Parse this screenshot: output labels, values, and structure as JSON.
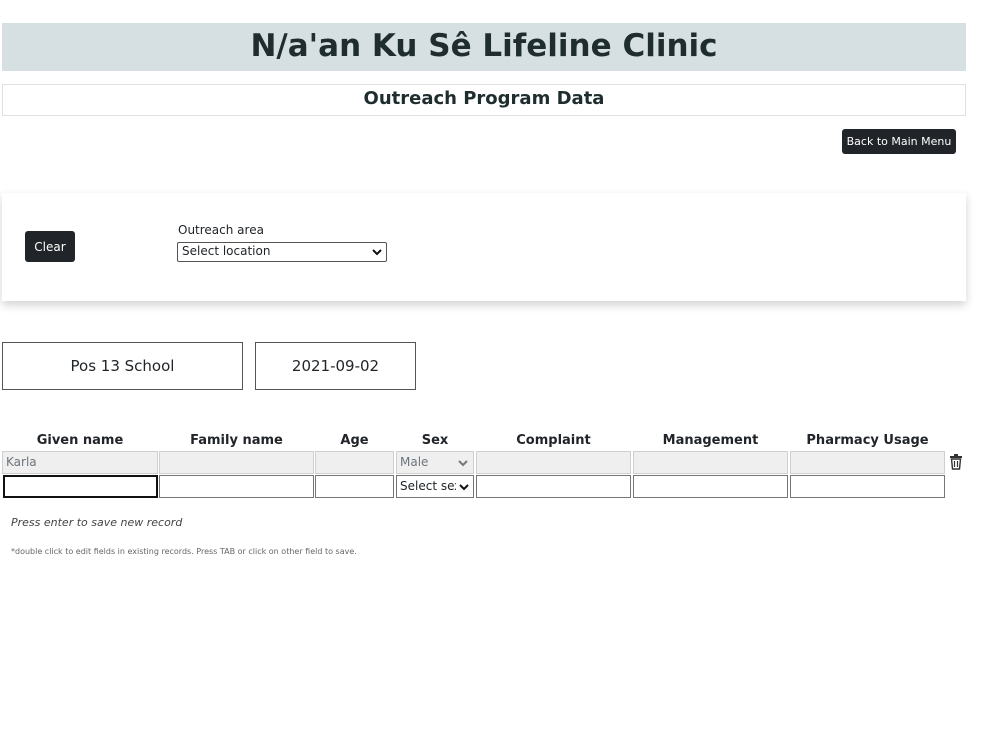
{
  "header": {
    "title": "N/a'an Ku Sê Lifeline Clinic",
    "subtitle": "Outreach Program Data"
  },
  "nav": {
    "back_label": "Back to Main Menu"
  },
  "filter": {
    "clear_label": "Clear",
    "area_label": "Outreach area",
    "location_select": "Select location"
  },
  "info": {
    "location": "Pos 13 School",
    "date": "2021-09-02"
  },
  "table": {
    "columns": [
      "Given name",
      "Family name",
      "Age",
      "Sex",
      "Complaint",
      "Management",
      "Pharmacy Usage"
    ],
    "rows": [
      {
        "given_name": "Karla",
        "family_name": "",
        "age": "",
        "sex": "Male",
        "complaint": "",
        "management": "",
        "pharmacy": ""
      }
    ],
    "new_row": {
      "sex_placeholder": "Select sex"
    }
  },
  "hints": {
    "save": "Press enter to save new record",
    "edit": "*double click to edit fields in existing records. Press TAB or click on other field to save."
  },
  "icons": {
    "row_delete": "trash-icon",
    "dropdown": "chevron-down-icon"
  }
}
